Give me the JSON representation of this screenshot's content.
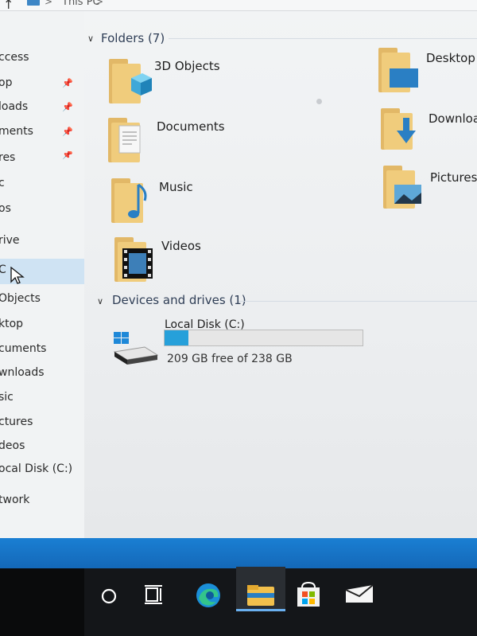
{
  "address_bar": {
    "crumb": "This PC",
    "separator": ">"
  },
  "nav_pane": {
    "items": [
      {
        "label": "ccess",
        "pinned": false
      },
      {
        "label": "op",
        "pinned": true
      },
      {
        "label": "loads",
        "pinned": true
      },
      {
        "label": "ments",
        "pinned": true
      },
      {
        "label": "res",
        "pinned": true
      },
      {
        "label": "c",
        "pinned": false
      },
      {
        "label": "os",
        "pinned": false
      },
      {
        "label": "rive",
        "pinned": false
      },
      {
        "label": "C",
        "pinned": false,
        "selected": true
      },
      {
        "label": "Objects",
        "pinned": false
      },
      {
        "label": "ktop",
        "pinned": false
      },
      {
        "label": "cuments",
        "pinned": false
      },
      {
        "label": "wnloads",
        "pinned": false
      },
      {
        "label": "sic",
        "pinned": false
      },
      {
        "label": "ctures",
        "pinned": false
      },
      {
        "label": "deos",
        "pinned": false
      },
      {
        "label": "ocal Disk (C:)",
        "pinned": false
      },
      {
        "label": "twork",
        "pinned": false
      }
    ]
  },
  "folders_section": {
    "header": "Folders (7)",
    "folders": [
      {
        "name": "3D Objects",
        "icon": "3d-objects-icon"
      },
      {
        "name": "Desktop",
        "icon": "desktop-folder-icon"
      },
      {
        "name": "Documents",
        "icon": "documents-folder-icon"
      },
      {
        "name": "Downloa",
        "icon": "downloads-folder-icon"
      },
      {
        "name": "Music",
        "icon": "music-folder-icon"
      },
      {
        "name": "Pictures",
        "icon": "pictures-folder-icon"
      },
      {
        "name": "Videos",
        "icon": "videos-folder-icon"
      }
    ]
  },
  "devices_section": {
    "header": "Devices and drives (1)",
    "drives": [
      {
        "name": "Local Disk (C:)",
        "free_text": "209 GB free of 238 GB",
        "used_fraction": 0.122
      }
    ]
  },
  "taskbar": {
    "icons": [
      "search-circle-icon",
      "task-view-icon",
      "edge-icon",
      "file-explorer-icon",
      "store-icon",
      "mail-icon"
    ],
    "active": "file-explorer-icon"
  },
  "colors": {
    "accent": "#26a0da",
    "folder": "#f0cc7c",
    "taskbar": "#141619"
  }
}
